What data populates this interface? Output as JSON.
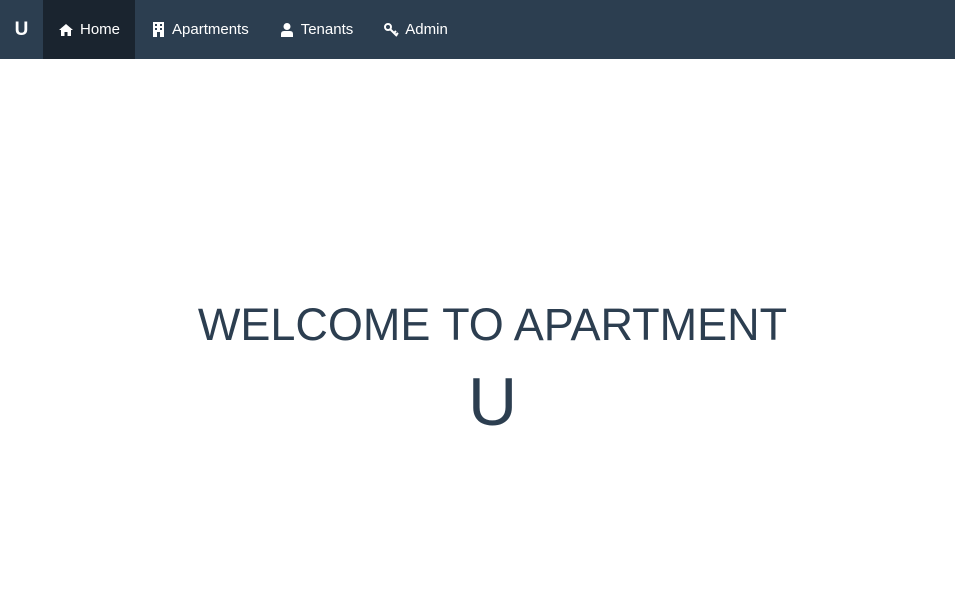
{
  "navbar": {
    "brand": "U",
    "items": [
      {
        "label": "Home",
        "icon": "home-icon",
        "active": true
      },
      {
        "label": "Apartments",
        "icon": "building-icon",
        "active": false
      },
      {
        "label": "Tenants",
        "icon": "user-icon",
        "active": false
      },
      {
        "label": "Admin",
        "icon": "key-icon",
        "active": false
      }
    ]
  },
  "hero": {
    "line1": "WELCOME TO APARTMENT",
    "line2": "U"
  },
  "colors": {
    "navbar_bg": "#2c3e50",
    "active_item_bg": "#1a242f",
    "heading_text": "#2c3e50"
  }
}
